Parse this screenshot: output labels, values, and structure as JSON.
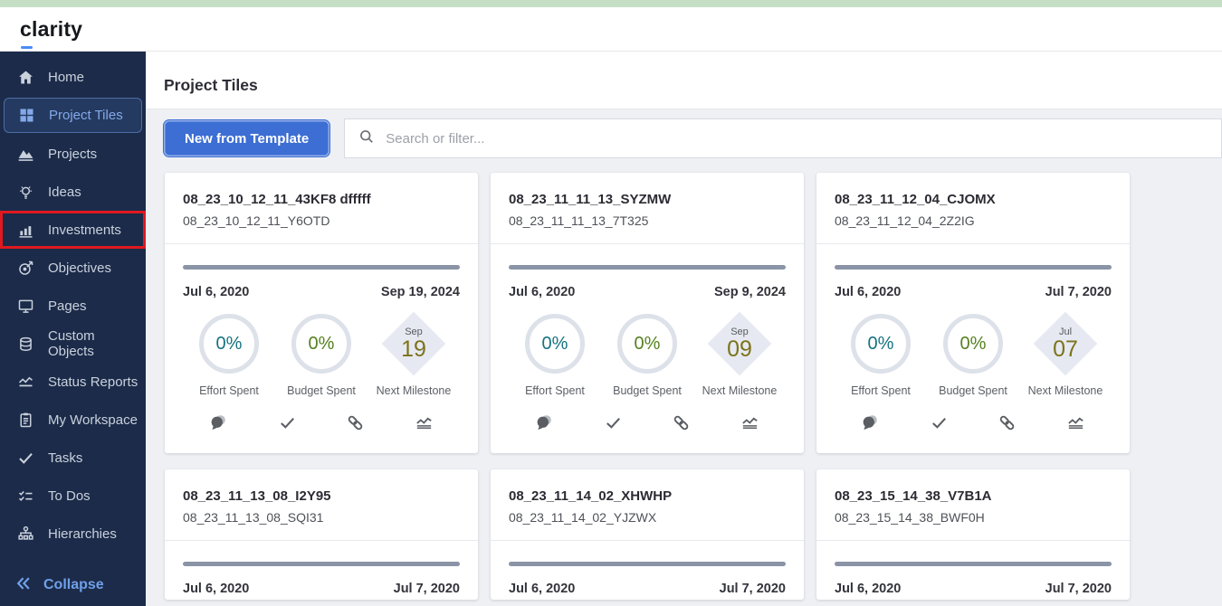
{
  "topbar": {
    "logo": "clarity"
  },
  "sidebar": {
    "items": [
      {
        "label": "Home",
        "icon": "home-icon"
      },
      {
        "label": "Project Tiles",
        "icon": "grid-icon",
        "selected": true
      },
      {
        "label": "Projects",
        "icon": "mountain-icon"
      },
      {
        "label": "Ideas",
        "icon": "lightbulb-icon"
      },
      {
        "label": "Investments",
        "icon": "bar-chart-icon",
        "annotated": true
      },
      {
        "label": "Objectives",
        "icon": "target-icon"
      },
      {
        "label": "Pages",
        "icon": "monitor-icon"
      },
      {
        "label": "Custom Objects",
        "icon": "database-icon"
      },
      {
        "label": "Status Reports",
        "icon": "trend-icon"
      },
      {
        "label": "My Workspace",
        "icon": "clipboard-icon"
      },
      {
        "label": "Tasks",
        "icon": "check-icon"
      },
      {
        "label": "To Dos",
        "icon": "checklist-icon"
      },
      {
        "label": "Hierarchies",
        "icon": "org-chart-icon"
      }
    ],
    "collapse_label": "Collapse"
  },
  "page": {
    "title": "Project Tiles"
  },
  "toolbar": {
    "new_from_template_label": "New from Template",
    "search_placeholder": "Search or filter..."
  },
  "card_labels": {
    "effort": "Effort Spent",
    "budget": "Budget Spent",
    "milestone": "Next Milestone"
  },
  "cards": [
    {
      "title": "08_23_10_12_11_43KF8 dfffff",
      "subtitle": "08_23_10_12_11_Y6OTD",
      "start_date": "Jul 6, 2020",
      "end_date": "Sep 19, 2024",
      "effort_spent": "0%",
      "budget_spent": "0%",
      "milestone_month": "Sep",
      "milestone_day": "19"
    },
    {
      "title": "08_23_11_11_13_SYZMW",
      "subtitle": "08_23_11_11_13_7T325",
      "start_date": "Jul 6, 2020",
      "end_date": "Sep 9, 2024",
      "effort_spent": "0%",
      "budget_spent": "0%",
      "milestone_month": "Sep",
      "milestone_day": "09"
    },
    {
      "title": "08_23_11_12_04_CJOMX",
      "subtitle": "08_23_11_12_04_2Z2IG",
      "start_date": "Jul 6, 2020",
      "end_date": "Jul 7, 2020",
      "effort_spent": "0%",
      "budget_spent": "0%",
      "milestone_month": "Jul",
      "milestone_day": "07"
    },
    {
      "title": "08_23_11_13_08_I2Y95",
      "subtitle": "08_23_11_13_08_SQI31",
      "start_date": "Jul 6, 2020",
      "end_date": "Jul 7, 2020"
    },
    {
      "title": "08_23_11_14_02_XHWHP",
      "subtitle": "08_23_11_14_02_YJZWX",
      "start_date": "Jul 6, 2020",
      "end_date": "Jul 7, 2020"
    },
    {
      "title": "08_23_15_14_38_V7B1A",
      "subtitle": "08_23_15_14_38_BWF0H",
      "start_date": "Jul 6, 2020",
      "end_date": "Jul 7, 2020"
    }
  ],
  "colors": {
    "top_strip_green": "#c5dfc6",
    "sidebar_navy": "#1c2b49",
    "selected_blue": "#83a9ea",
    "annotation_red": "#e0191f",
    "primary_button_blue": "#3c6ed3",
    "effort_teal": "#15737f",
    "budget_green": "#55811e",
    "milestone_gold": "#7c731b"
  }
}
